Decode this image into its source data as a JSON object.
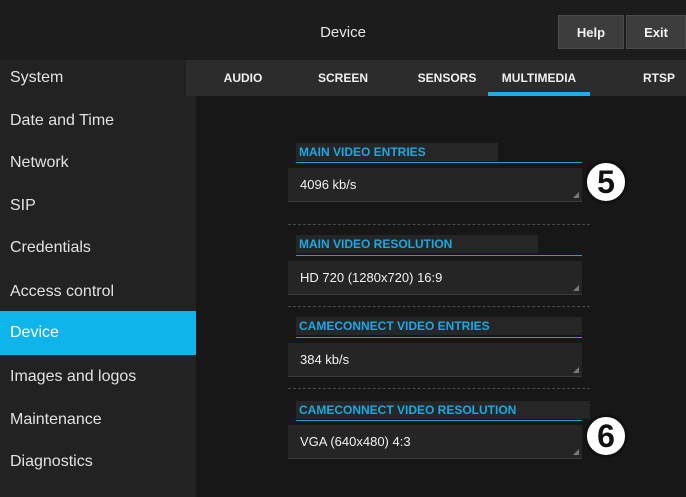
{
  "header": {
    "title": "Device",
    "help_label": "Help",
    "exit_label": "Exit"
  },
  "sidebar": {
    "items": [
      {
        "label": "System"
      },
      {
        "label": "Date and Time"
      },
      {
        "label": "Network"
      },
      {
        "label": "SIP"
      },
      {
        "label": "Credentials"
      },
      {
        "label": "Access control"
      },
      {
        "label": "Device",
        "active": true
      },
      {
        "label": "Images and logos"
      },
      {
        "label": "Maintenance"
      },
      {
        "label": "Diagnostics"
      }
    ]
  },
  "tabs": [
    {
      "label": "AUDIO"
    },
    {
      "label": "SCREEN"
    },
    {
      "label": "SENSORS"
    },
    {
      "label": "MULTIMEDIA",
      "active": true
    },
    {
      "label": "RTSP"
    }
  ],
  "sections": [
    {
      "label": "MAIN VIDEO ENTRIES",
      "value": "4096 kb/s"
    },
    {
      "label": "MAIN VIDEO RESOLUTION",
      "value": "HD 720 (1280x720) 16:9"
    },
    {
      "label": "CAMECONNECT VIDEO ENTRIES",
      "value": "384 kb/s"
    },
    {
      "label": "CAMECONNECT VIDEO RESOLUTION",
      "value": "VGA (640x480) 4:3"
    }
  ],
  "callouts": [
    {
      "number": "5"
    },
    {
      "number": "6"
    }
  ],
  "colors": {
    "accent": "#0fb4ea",
    "label_text": "#19a9e6"
  }
}
